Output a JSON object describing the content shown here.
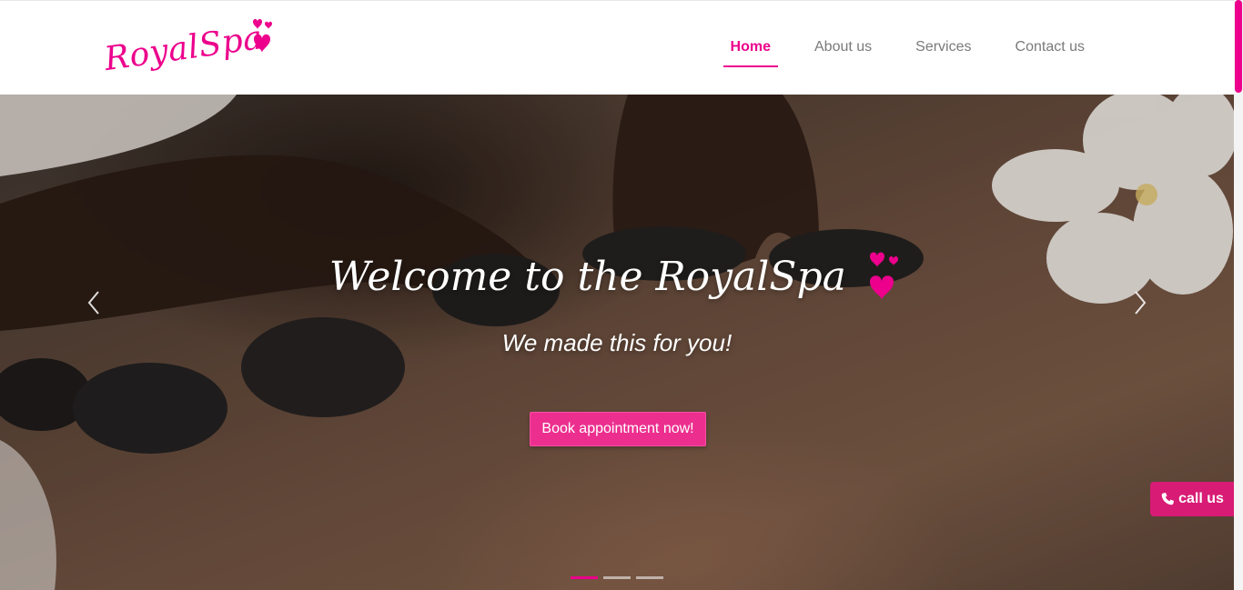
{
  "brand": {
    "name": "RoyalSpa",
    "accent_color": "#ec008c",
    "logo_icon": "hearts-icon"
  },
  "nav": {
    "items": [
      {
        "label": "Home",
        "active": true
      },
      {
        "label": "About us",
        "active": false
      },
      {
        "label": "Services",
        "active": false
      },
      {
        "label": "Contact us",
        "active": false
      }
    ]
  },
  "hero": {
    "title": "Welcome to the RoyalSpa",
    "subtitle": "We made this for you!",
    "cta_label": "Book appointment now!",
    "prev_icon": "chevron-left-icon",
    "next_icon": "chevron-right-icon",
    "slides_count": 3,
    "active_slide": 1
  },
  "call_widget": {
    "label": "call us",
    "icon": "phone-icon",
    "color": "#d81b75"
  }
}
